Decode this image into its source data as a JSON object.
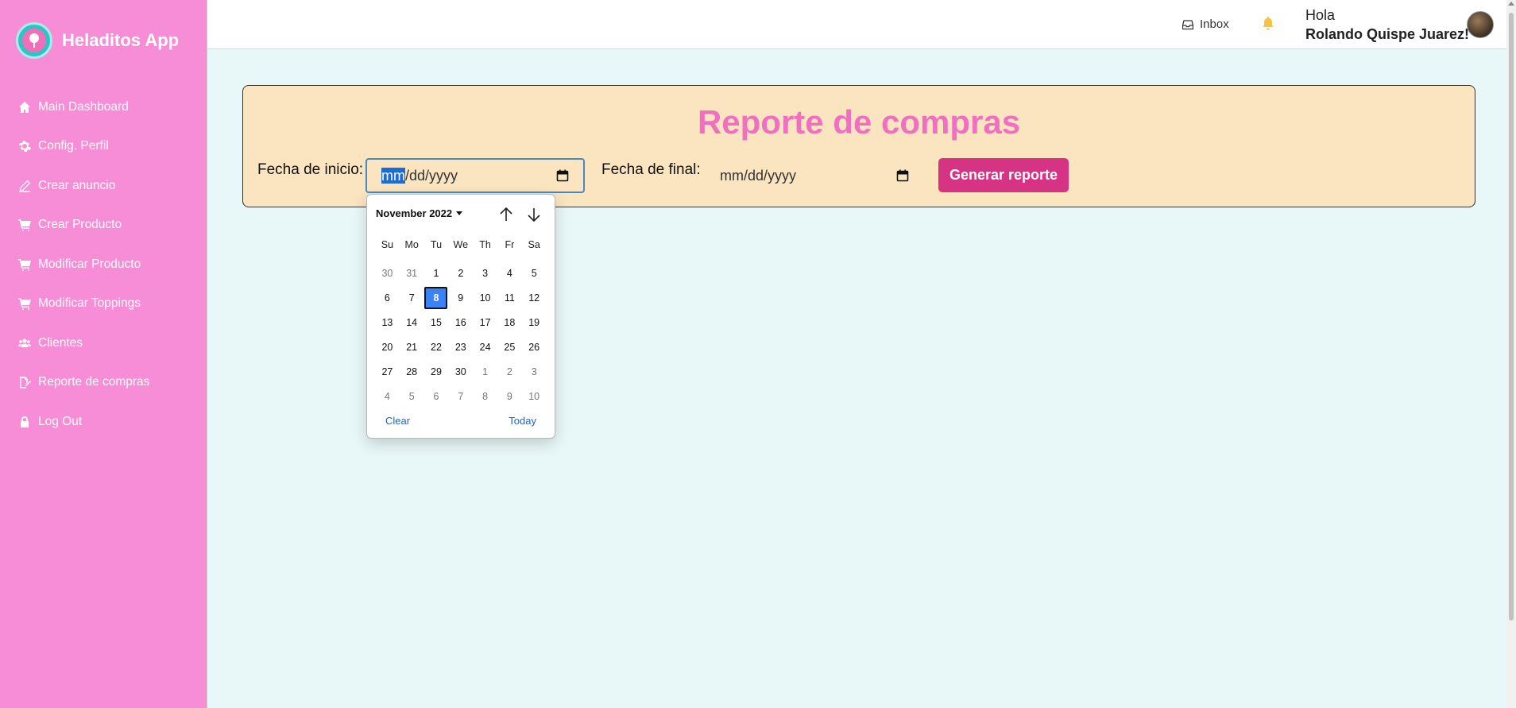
{
  "app": {
    "name": "Heladitos App"
  },
  "sidebar": {
    "items": [
      {
        "label": "Main Dashboard",
        "icon": "home-icon"
      },
      {
        "label": "Config. Perfil",
        "icon": "gear-icon"
      },
      {
        "label": "Crear anuncio",
        "icon": "pen-icon"
      },
      {
        "label": "Crear Producto",
        "icon": "cart-plus-icon"
      },
      {
        "label": "Modificar Producto",
        "icon": "cart-plus-icon"
      },
      {
        "label": "Modificar Toppings",
        "icon": "cart-plus-icon"
      },
      {
        "label": "Clientes",
        "icon": "users-icon"
      },
      {
        "label": "Reporte de compras",
        "icon": "file-signature-icon"
      },
      {
        "label": "Log Out",
        "icon": "lock-icon"
      }
    ]
  },
  "header": {
    "inbox_label": "Inbox",
    "greeting": "Hola",
    "user_name": "Rolando Quispe Juarez!"
  },
  "report": {
    "title": "Reporte de compras",
    "start_label": "Fecha de inicio:",
    "start_value_month": "mm",
    "start_value_rest": "/dd/yyyy",
    "end_label": "Fecha de final:",
    "end_value": "mm/dd/yyyy",
    "button_label": "Generar reporte"
  },
  "calendar": {
    "month_label": "November 2022",
    "weekdays": [
      "Su",
      "Mo",
      "Tu",
      "We",
      "Th",
      "Fr",
      "Sa"
    ],
    "weeks": [
      [
        "30",
        "31",
        "1",
        "2",
        "3",
        "4",
        "5"
      ],
      [
        "6",
        "7",
        "8",
        "9",
        "10",
        "11",
        "12"
      ],
      [
        "13",
        "14",
        "15",
        "16",
        "17",
        "18",
        "19"
      ],
      [
        "20",
        "21",
        "22",
        "23",
        "24",
        "25",
        "26"
      ],
      [
        "27",
        "28",
        "29",
        "30",
        "1",
        "2",
        "3"
      ],
      [
        "4",
        "5",
        "6",
        "7",
        "8",
        "9",
        "10"
      ]
    ],
    "selected_day": "8",
    "clear_label": "Clear",
    "today_label": "Today"
  },
  "colors": {
    "sidebar": "#f78dd6",
    "title": "#f06fc1",
    "button": "#d63384",
    "card": "#fbe5c0",
    "selected": "#3b82f6"
  }
}
